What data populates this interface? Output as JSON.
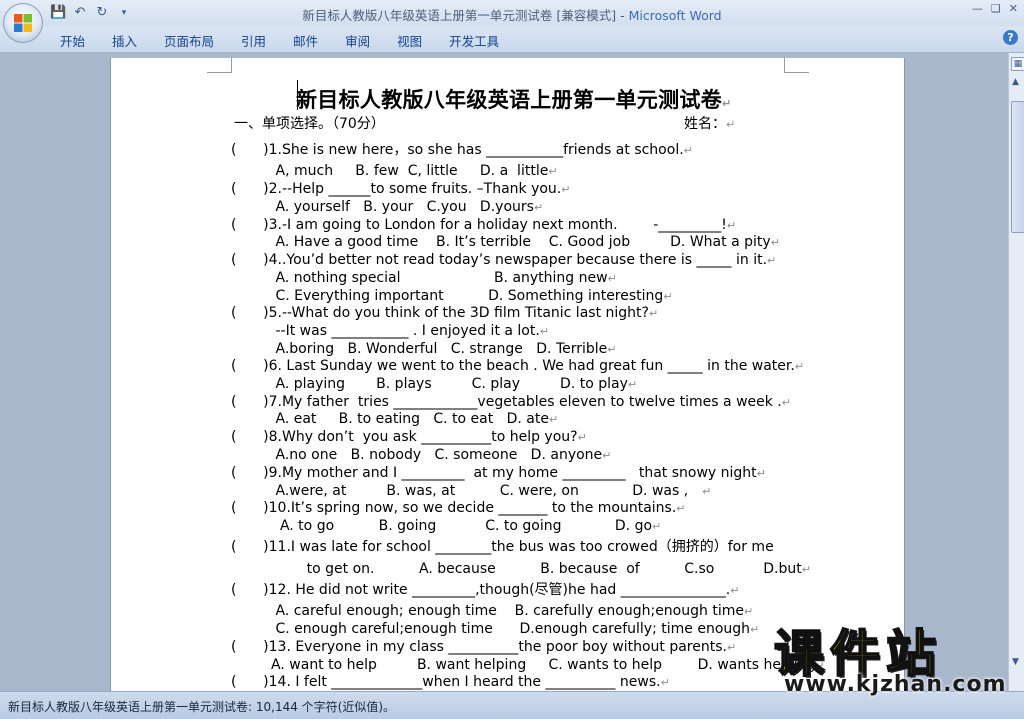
{
  "window": {
    "title": "新目标人教版八年级英语上册第一单元测试卷 [兼容模式] - ",
    "app": "Microsoft Word"
  },
  "ribbon": {
    "tabs": [
      "开始",
      "插入",
      "页面布局",
      "引用",
      "邮件",
      "审阅",
      "视图",
      "开发工具"
    ]
  },
  "document": {
    "title": "新目标人教版八年级英语上册第一单元测试卷",
    "section_heading": "一、单项选择。（70分）",
    "name_label": "姓名：",
    "lines": [
      "(      )1.She is new here，so she has ___________friends at school.",
      "          A, much     B. few  C, little     D. a  little",
      "(      )2.--Help ______to some fruits. –Thank you.",
      "          A. yourself   B. your   C.you   D.yours",
      "(      )3.-I am going to London for a holiday next month.        -_________!",
      "          A. Have a good time    B. It’s terrible    C. Good job         D. What a pity",
      "(      )4..You’d better not read today’s newspaper because there is _____ in it.",
      "          A. nothing special                     B. anything new",
      "          C. Everything important          D. Something interesting",
      "(      )5.--What do you think of the 3D film Titanic last night?",
      "          --It was ___________ . I enjoyed it a lot.",
      "          A.boring   B. Wonderful   C. strange   D. Terrible",
      "(      )6. Last Sunday we went to the beach . We had great fun _____ in the water.",
      "          A. playing       B. plays         C. play         D. to play",
      "(      )7.My father  tries ____________vegetables eleven to twelve times a week .",
      "          A. eat     B. to eating   C. to eat   D. ate",
      "(      )8.Why don’t  you ask __________to help you?",
      "          A.no one   B. nobody   C. someone   D. anyone",
      "(      )9.My mother and I _________  at my home _________   that snowy night",
      "          A.were, at         B. was, at          C. were, on            D. was ,",
      "(      )10.It’s spring now, so we decide _______ to the mountains.",
      "           A. to go          B. going           C. to going            D. go",
      "(      )11.I was late for school ________the bus was too crowed（拥挤的）for me",
      "                 to get on.          A. because          B. because  of          C.so           D.but",
      "(      )12. He did not write _________,though(尽管)he had _______________.",
      "          A. careful enough; enough time    B. carefully enough;enough time",
      "          C. enough careful;enough time      D.enough carefully; time enough",
      "(      )13. Everyone in my class __________the poor boy without parents.",
      "         A. want to help         B. want helping     C. wants to help        D. wants helping",
      "(      )14. I felt _____________when I heard the __________ news."
    ]
  },
  "status": {
    "text": "新目标人教版八年级英语上册第一单元测试卷: 10,144 个字符(近似值)。"
  },
  "watermark": {
    "cn": "课件站",
    "url": "www.kjzhan.com"
  },
  "colors": {
    "ribbon_text": "#15428b",
    "page_bg": "#ffffff",
    "workspace_bg": "#a9b7cd",
    "watermark_yellow": "#f4e100"
  }
}
